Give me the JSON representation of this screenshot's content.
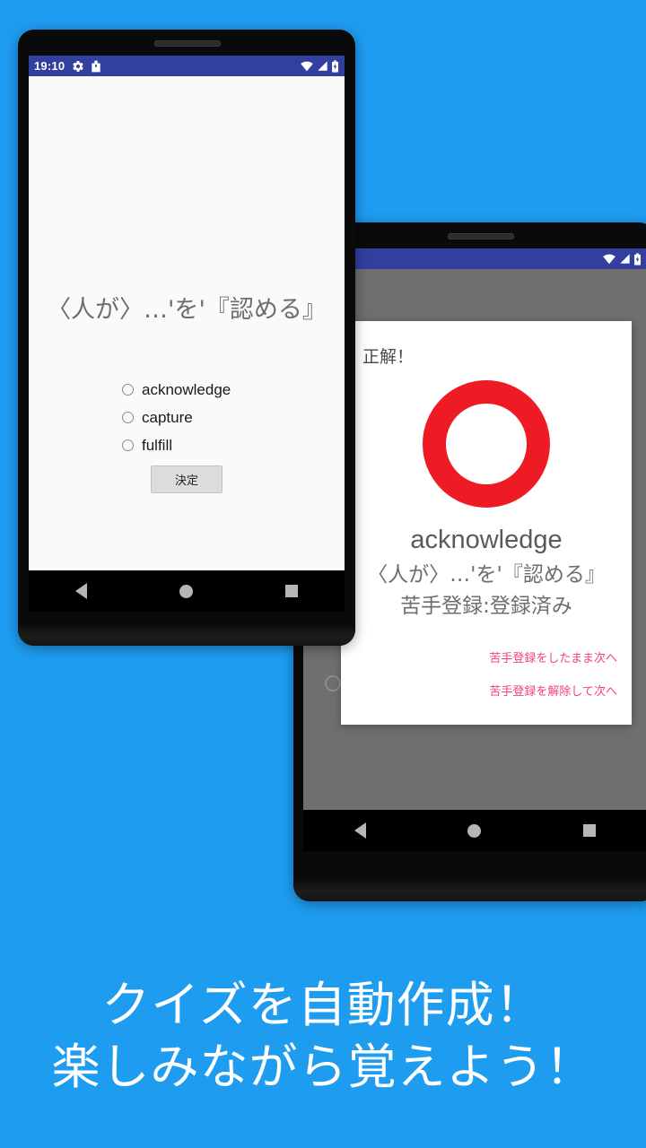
{
  "background": {
    "color": "#1e9cf0"
  },
  "phone_front": {
    "status_bar": {
      "time": "19:10",
      "left_icons": [
        "gear-icon",
        "shopping-bag-icon"
      ],
      "right_icons": [
        "wifi-icon",
        "signal-icon",
        "battery-icon"
      ],
      "color": "#333f9e"
    },
    "quiz": {
      "question": "〈人が〉…'を'『認める』",
      "options": [
        {
          "label": "acknowledge",
          "selected": false
        },
        {
          "label": "capture",
          "selected": false
        },
        {
          "label": "fulfill",
          "selected": false
        }
      ],
      "submit_label": "決定"
    },
    "nav_bar": {
      "back": "back-triangle",
      "home": "home-circle",
      "recents": "recents-square"
    }
  },
  "phone_back": {
    "status_bar": {
      "time": "",
      "left_icons": [
        "gear-icon",
        "shopping-bag-icon"
      ],
      "right_icons": [
        "wifi-icon",
        "signal-icon",
        "battery-icon"
      ],
      "color": "#333f9e"
    },
    "dialog": {
      "title": "正解！",
      "result_mark": "red-circle-correct",
      "result_color": "#ee1b24",
      "word": "acknowledge",
      "meaning": "〈人が〉…'を'『認める』",
      "registration_status": "苦手登録:登録済み",
      "actions": [
        {
          "label": "苦手登録をしたまま次へ",
          "color": "#f0427a"
        },
        {
          "label": "苦手登録を解除して次へ",
          "color": "#f0427a"
        }
      ]
    },
    "nav_bar": {
      "back": "back-triangle",
      "home": "home-circle",
      "recents": "recents-square"
    }
  },
  "caption": {
    "line1": "クイズを自動作成！",
    "line2": "楽しみながら覚えよう！",
    "color": "#ffffff"
  }
}
